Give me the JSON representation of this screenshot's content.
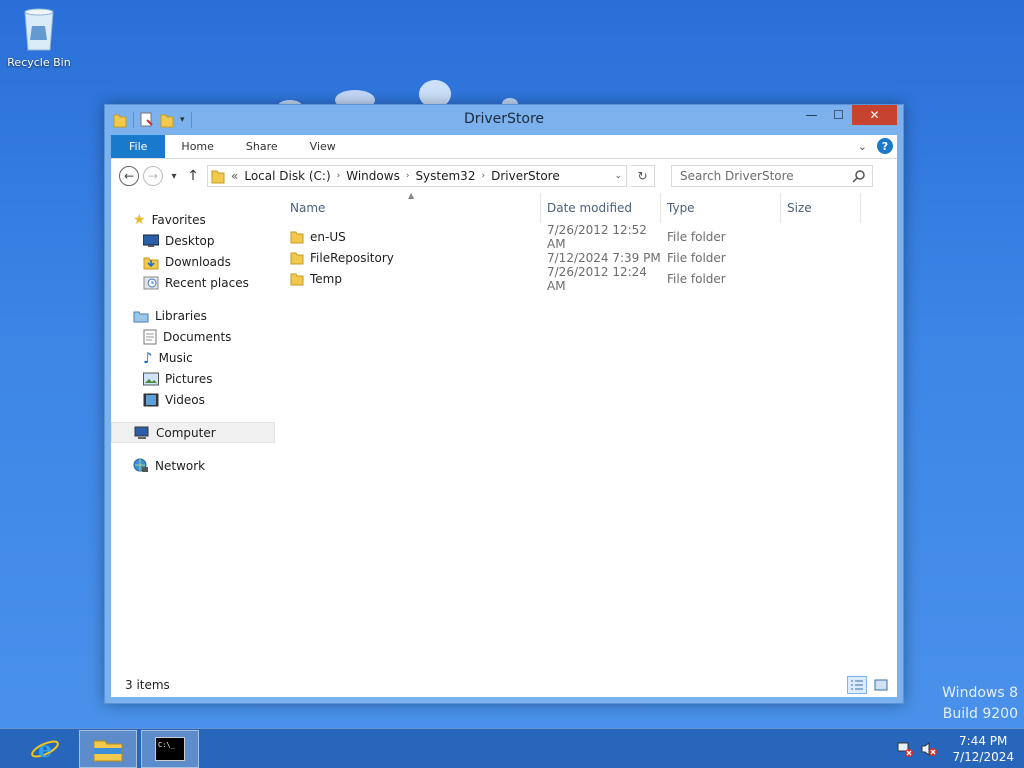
{
  "desktop": {
    "recycle_bin_label": "Recycle Bin",
    "build_line1": "Windows 8",
    "build_line2": "Build 9200"
  },
  "window": {
    "title": "DriverStore",
    "controls": {
      "minimize": "—",
      "maximize": "☐",
      "close": "✕"
    }
  },
  "ribbon": {
    "tabs": [
      {
        "label": "File",
        "active": true
      },
      {
        "label": "Home"
      },
      {
        "label": "Share"
      },
      {
        "label": "View"
      }
    ],
    "help_label": "?"
  },
  "address": {
    "overflow": "«",
    "crumbs": [
      "Local Disk (C:)",
      "Windows",
      "System32",
      "DriverStore"
    ],
    "search_placeholder": "Search DriverStore"
  },
  "nav_pane": {
    "favorites": {
      "label": "Favorites",
      "items": [
        "Desktop",
        "Downloads",
        "Recent places"
      ]
    },
    "libraries": {
      "label": "Libraries",
      "items": [
        "Documents",
        "Music",
        "Pictures",
        "Videos"
      ]
    },
    "computer": "Computer",
    "network": "Network"
  },
  "file_list": {
    "columns": [
      "Name",
      "Date modified",
      "Type",
      "Size"
    ],
    "rows": [
      {
        "name": "en-US",
        "date": "7/26/2012 12:52 AM",
        "type": "File folder"
      },
      {
        "name": "FileRepository",
        "date": "7/12/2024 7:39 PM",
        "type": "File folder"
      },
      {
        "name": "Temp",
        "date": "7/26/2012 12:24 AM",
        "type": "File folder"
      }
    ]
  },
  "status": {
    "item_count": "3 items"
  },
  "taskbar": {
    "time": "7:44 PM",
    "date": "7/12/2024",
    "items": [
      "internet-explorer",
      "file-explorer",
      "command-prompt"
    ]
  },
  "colors": {
    "accent": "#1979ca",
    "window_frame": "#7bb1ec",
    "close_button": "#c7432f"
  }
}
